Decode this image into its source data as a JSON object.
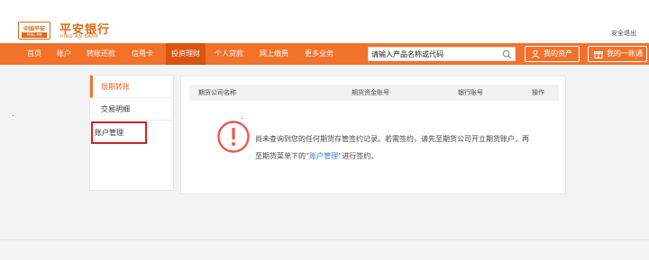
{
  "header": {
    "logo_text": "中国平安",
    "logo_sub": "PING AN",
    "brand_cn": "平安银行",
    "brand_en": "PING AN BANK",
    "logout": "安全退出"
  },
  "nav": {
    "items": [
      "首页",
      "账户",
      "转账还款",
      "信用卡",
      "投资理财",
      "个人贷款",
      "网上缴费",
      "更多业务"
    ],
    "active_index": 4,
    "search_placeholder": "请输入产品名称或代码",
    "assets_label": "我的资产",
    "overview_label": "我的一账通"
  },
  "sidebar": {
    "items": [
      {
        "label": "银期转账",
        "active": true
      },
      {
        "label": "交易明细",
        "active": false
      },
      {
        "label": "账户管理",
        "active": false,
        "highlighted": true
      }
    ]
  },
  "table": {
    "columns": [
      "期货公司名称",
      "期货资金账号",
      "银行账号",
      "操作"
    ],
    "empty_message_1": "尚未查询到您的任何期货存管签约记录。若需签约，请先至期货公司开立期货账户，再",
    "empty_message_2_prefix": "至期货菜单下的",
    "empty_message_link": "“账户管理”",
    "empty_message_2_suffix": "进行签约。"
  },
  "colors": {
    "accent": "#f0722b",
    "accent_dark": "#d85510",
    "brand": "#e06a1d",
    "warning": "#e8594a",
    "link": "#2d7ad6",
    "highlight_border": "#d41f1f"
  }
}
